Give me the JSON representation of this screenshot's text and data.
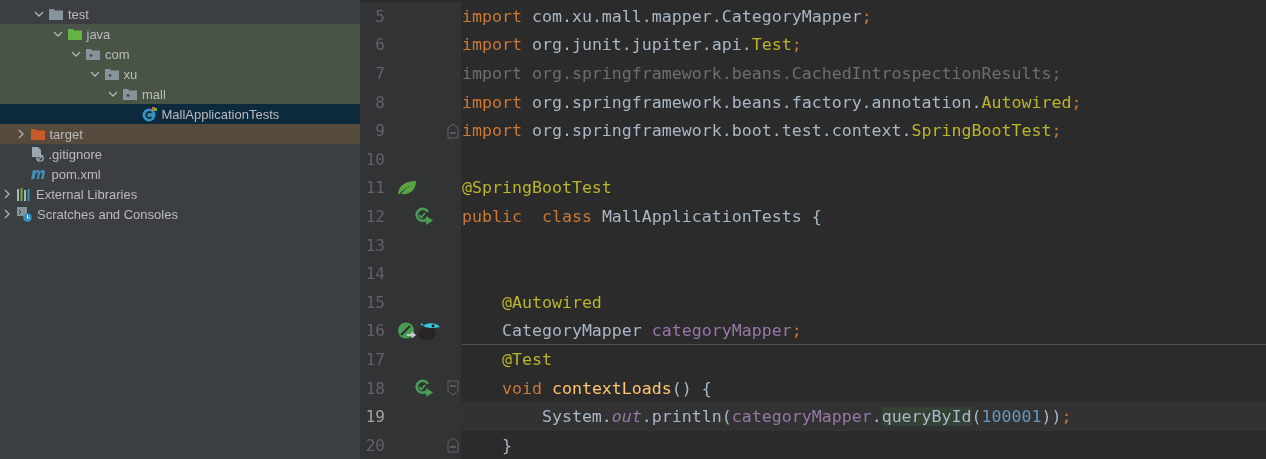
{
  "project_tree": [
    {
      "children": [
        {
          "children": [
            {
              "label": "test",
              "kind": "folder",
              "expanded": true,
              "selected": false,
              "test_source": false,
              "excluded": false,
              "children": [
                {
                  "label": "java",
                  "kind": "test-folder",
                  "expanded": true,
                  "selected": false,
                  "test_source": true,
                  "excluded": false,
                  "children": [
                    {
                      "label": "com",
                      "kind": "package",
                      "expanded": true,
                      "selected": false,
                      "test_source": true,
                      "excluded": false,
                      "children": [
                        {
                          "label": "xu",
                          "kind": "package",
                          "expanded": true,
                          "selected": false,
                          "test_source": true,
                          "excluded": false,
                          "children": [
                            {
                              "label": "mall",
                              "kind": "package",
                              "expanded": true,
                              "selected": false,
                              "test_source": true,
                              "excluded": false,
                              "children": [
                                {
                                  "label": "MallApplicationTests",
                                  "kind": "test-class",
                                  "selected": true
                                }
                              ]
                            }
                          ]
                        }
                      ]
                    }
                  ]
                }
              ]
            }
          ]
        },
        {
          "label": "target",
          "kind": "excluded-folder",
          "expanded": false,
          "selected": false,
          "test_source": false,
          "excluded": true
        },
        {
          "label": ".gitignore",
          "kind": "ignore-file",
          "selected": false,
          "test_source": false,
          "excluded": false
        },
        {
          "label": "pom.xml",
          "kind": "maven",
          "selected": false,
          "test_source": false,
          "excluded": false
        }
      ]
    },
    {
      "label": "External Libraries",
      "kind": "libraries",
      "expanded": false,
      "selected": false,
      "test_source": false,
      "excluded": false
    },
    {
      "label": "Scratches and Consoles",
      "kind": "scratches",
      "expanded": false,
      "selected": false,
      "test_source": false,
      "excluded": false
    }
  ],
  "editor": {
    "lines": [
      {
        "number": "5",
        "current": false,
        "tokens": [
          {
            "kind": "keyword",
            "text": "import "
          },
          {
            "kind": "plain",
            "text": "com.xu.mall.mapper.CategoryMapper"
          },
          {
            "kind": "punct",
            "text": ";"
          }
        ]
      },
      {
        "number": "6",
        "current": false,
        "tokens": [
          {
            "kind": "keyword",
            "text": "import "
          },
          {
            "kind": "plain",
            "text": "org.junit.jupiter.api."
          },
          {
            "kind": "annotation",
            "text": "Test"
          },
          {
            "kind": "punct",
            "text": ";"
          }
        ]
      },
      {
        "number": "7",
        "current": false,
        "tokens": [
          {
            "kind": "unused",
            "text": "import org.springframework.beans.CachedIntrospectionResults;"
          }
        ]
      },
      {
        "number": "8",
        "current": false,
        "tokens": [
          {
            "kind": "keyword",
            "text": "import "
          },
          {
            "kind": "plain",
            "text": "org.springframework.beans.factory.annotation."
          },
          {
            "kind": "annotation",
            "text": "Autowired"
          },
          {
            "kind": "punct",
            "text": ";"
          }
        ]
      },
      {
        "number": "9",
        "current": false,
        "fold_end": true,
        "tokens": [
          {
            "kind": "keyword",
            "text": "import "
          },
          {
            "kind": "plain",
            "text": "org.springframework.boot.test.context."
          },
          {
            "kind": "annotation",
            "text": "SpringBootTest"
          },
          {
            "kind": "punct",
            "text": ";"
          }
        ]
      },
      {
        "number": "10",
        "current": false
      },
      {
        "number": "11",
        "current": false,
        "gutter": [
          {
            "kind": "spring-leaf"
          }
        ],
        "tokens": [
          {
            "kind": "annotation",
            "text": "@SpringBootTest"
          }
        ]
      },
      {
        "number": "12",
        "current": false,
        "gutter": [
          {
            "kind": "run-test"
          }
        ],
        "tokens": [
          {
            "kind": "keyword",
            "text": "public  class "
          },
          {
            "kind": "plain",
            "text": "MallApplicationTests {"
          }
        ]
      },
      {
        "number": "13",
        "current": false
      },
      {
        "number": "14",
        "current": false
      },
      {
        "number": "15",
        "current": false,
        "tokens": [
          {
            "kind": "annotation",
            "text": "    @Autowired"
          }
        ]
      },
      {
        "number": "16",
        "current": false,
        "gutter": [
          {
            "kind": "bean-injection"
          },
          {
            "kind": "mybatis-bird"
          }
        ],
        "separator_below": true,
        "tokens": [
          {
            "kind": "plain",
            "text": "    CategoryMapper "
          },
          {
            "kind": "field",
            "text": "categoryMapper"
          },
          {
            "kind": "punct",
            "text": ";"
          }
        ]
      },
      {
        "number": "17",
        "current": false,
        "tokens": [
          {
            "kind": "annotation",
            "text": "    @Test"
          }
        ]
      },
      {
        "number": "18",
        "current": false,
        "fold_start": true,
        "gutter": [
          {
            "kind": "run-test"
          }
        ],
        "tokens": [
          {
            "kind": "keyword",
            "text": "    void "
          },
          {
            "kind": "method",
            "text": "contextLoads"
          },
          {
            "kind": "plain",
            "text": "() {"
          }
        ]
      },
      {
        "number": "19",
        "current": true,
        "tokens": [
          {
            "kind": "plain",
            "text": "        System."
          },
          {
            "kind": "static",
            "text": "out"
          },
          {
            "kind": "plain",
            "text": ".println("
          },
          {
            "kind": "field",
            "text": "categoryMapper"
          },
          {
            "kind": "plain",
            "text": "."
          },
          {
            "kind": "highlighted",
            "text": "queryById"
          },
          {
            "kind": "plain",
            "text": "("
          },
          {
            "kind": "number",
            "text": "100001"
          },
          {
            "kind": "plain",
            "text": "))"
          },
          {
            "kind": "punct",
            "text": ";"
          }
        ]
      },
      {
        "number": "20",
        "current": false,
        "fold_end": true,
        "tokens": [
          {
            "kind": "plain",
            "text": "    }"
          }
        ]
      }
    ]
  }
}
